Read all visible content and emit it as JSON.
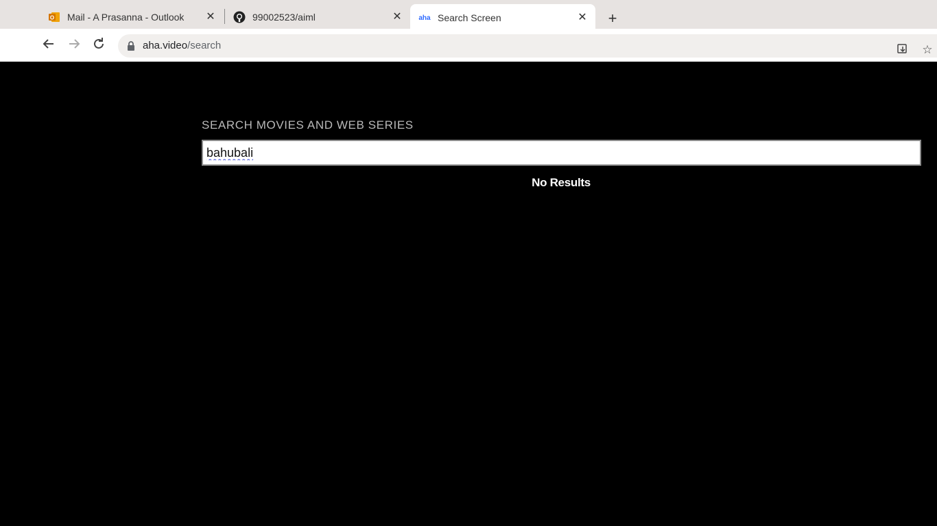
{
  "browser": {
    "tabs": [
      {
        "title": "Mail - A Prasanna - Outlook",
        "icon": "outlook-icon",
        "active": false
      },
      {
        "title": "99002523/aiml",
        "icon": "github-icon",
        "active": false
      },
      {
        "title": "Search Screen",
        "icon": "aha-icon",
        "favicon_text": "aha",
        "active": true
      }
    ],
    "new_tab_label": "+",
    "address": {
      "domain": "aha.video",
      "path": "/search"
    }
  },
  "search": {
    "label": "SEARCH MOVIES AND WEB SERIES",
    "query": "bahubali",
    "empty_message": "No Results"
  },
  "colors": {
    "page_background": "#000000",
    "tabstrip": "#e7e3e1",
    "label_gray": "#b9b9b9",
    "aha_blue": "#2f6bff"
  }
}
